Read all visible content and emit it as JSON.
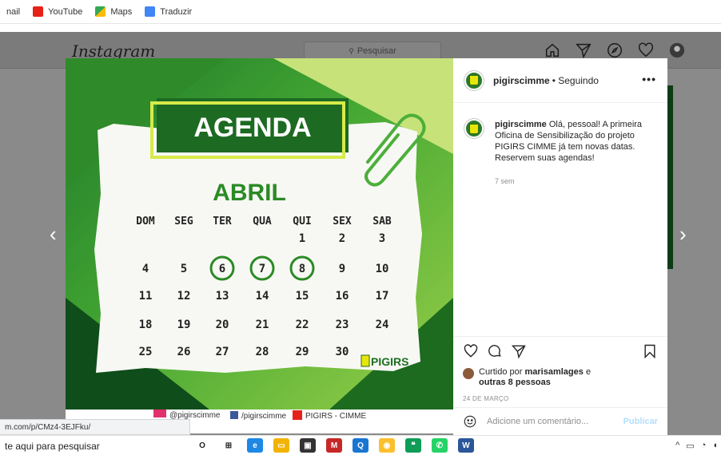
{
  "bookmarks": [
    {
      "label": "nail",
      "icon": "mail-icon",
      "color": ""
    },
    {
      "label": "YouTube",
      "icon": "youtube-icon",
      "color": "#e62117"
    },
    {
      "label": "Maps",
      "icon": "maps-icon",
      "color": "#34a853"
    },
    {
      "label": "Traduzir",
      "icon": "translate-icon",
      "color": "#4285f4"
    }
  ],
  "instagram": {
    "logo": "Instagram",
    "search_placeholder": "Pesquisar"
  },
  "post": {
    "heading": "AGENDA",
    "month": "ABRIL",
    "weekdays": [
      "DOM",
      "SEG",
      "TER",
      "QUA",
      "QUI",
      "SEX",
      "SAB"
    ],
    "weeks": [
      [
        "",
        "",
        "",
        "",
        "1",
        "2",
        "3"
      ],
      [
        "4",
        "5",
        "6",
        "7",
        "8",
        "9",
        "10"
      ],
      [
        "11",
        "12",
        "13",
        "14",
        "15",
        "16",
        "17"
      ],
      [
        "18",
        "19",
        "20",
        "21",
        "22",
        "23",
        "24"
      ],
      [
        "25",
        "26",
        "27",
        "28",
        "29",
        "30",
        ""
      ]
    ],
    "highlighted_days": [
      "6",
      "7",
      "8"
    ],
    "brand": "PIGIRS",
    "footer_instagram": "@pigirscimme",
    "footer_facebook": "/pigirscimme",
    "footer_youtube": "PIGIRS - CIMME"
  },
  "sidebar": {
    "username": "pigirscimme",
    "follow_status": "• Seguindo",
    "more": "•••",
    "caption_user": "pigirscimme",
    "caption": "Olá, pessoal! A primeira Oficina de Sensibilização do projeto PIGIRS CIMME já tem novas datas. Reservem suas agendas!",
    "time_ago": "7 sem",
    "liked_prefix": "Curtido por",
    "liked_user": "marisamlages",
    "liked_suffix": "e",
    "liked_others": "outras 8 pessoas",
    "date": "24 DE MARÇO",
    "comment_placeholder": "Adicione um comentário...",
    "publish": "Publicar"
  },
  "status_url": "m.com/p/CMz4-3EJFku/",
  "taskbar": {
    "search_text": "te aqui para pesquisar",
    "apps": [
      {
        "name": "cortana-icon",
        "label": "O",
        "color": "#ffffff"
      },
      {
        "name": "task-view-icon",
        "label": "⊞",
        "color": "#ffffff"
      },
      {
        "name": "edge-icon",
        "label": "e",
        "color": "#1e88e5"
      },
      {
        "name": "file-explorer-icon",
        "label": "▭",
        "color": "#f2b300"
      },
      {
        "name": "store-icon",
        "label": "▣",
        "color": "#333333"
      },
      {
        "name": "mcafee-icon",
        "label": "M",
        "color": "#c62828"
      },
      {
        "name": "app-q-icon",
        "label": "Q",
        "color": "#1976d2"
      },
      {
        "name": "chrome-icon",
        "label": "◉",
        "color": "#fbc02d"
      },
      {
        "name": "hangouts-icon",
        "label": "❝",
        "color": "#0f9d58"
      },
      {
        "name": "whatsapp-icon",
        "label": "✆",
        "color": "#25d366"
      },
      {
        "name": "word-icon",
        "label": "W",
        "color": "#2b579a"
      }
    ]
  }
}
